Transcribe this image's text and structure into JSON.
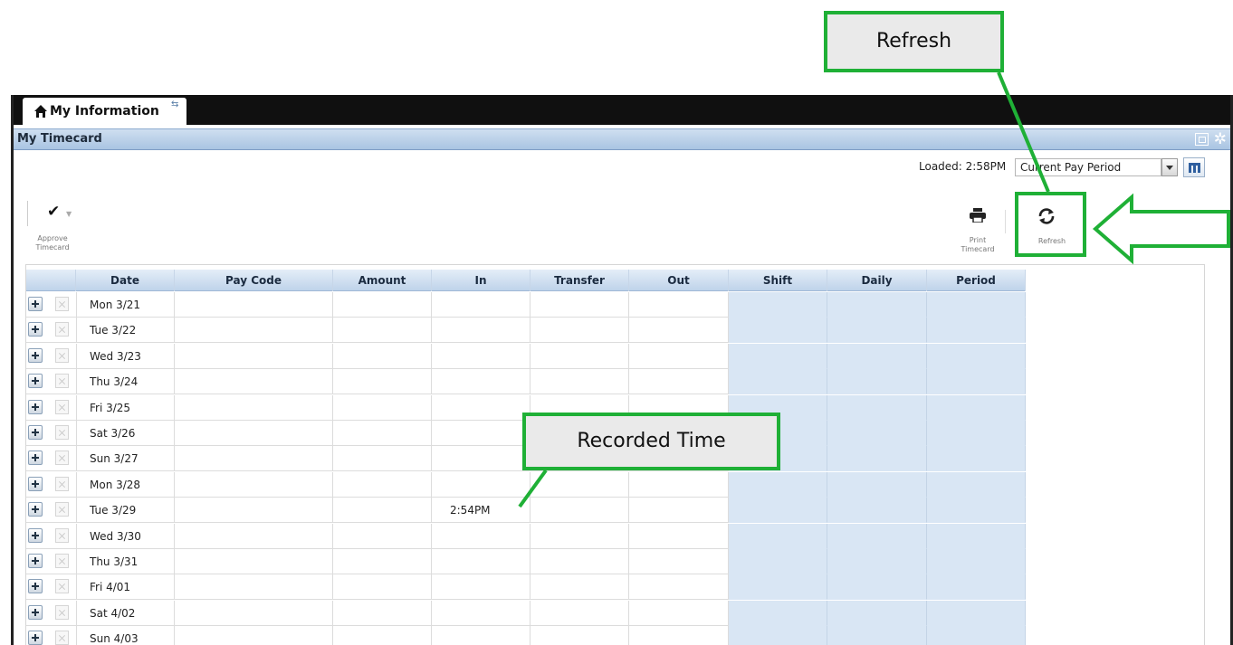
{
  "tab": {
    "label": "My Information",
    "sync_glyph": "⇆",
    "icon": "home-icon"
  },
  "panel": {
    "title": "My Timecard"
  },
  "loaded": {
    "text": "Loaded: 2:58PM"
  },
  "period_select": {
    "value": "Current Pay Period"
  },
  "toolbar": {
    "approve_label_1": "Approve",
    "approve_label_2": "Timecard",
    "print_label_1": "Print",
    "print_label_2": "Timecard",
    "refresh_label": "Refresh"
  },
  "table": {
    "columns": [
      "Date",
      "Pay Code",
      "Amount",
      "In",
      "Transfer",
      "Out",
      "Shift",
      "Daily",
      "Period"
    ],
    "rows": [
      {
        "date": "Mon 3/21",
        "in": ""
      },
      {
        "date": "Tue 3/22",
        "in": ""
      },
      {
        "date": "Wed 3/23",
        "in": ""
      },
      {
        "date": "Thu 3/24",
        "in": ""
      },
      {
        "date": "Fri 3/25",
        "in": ""
      },
      {
        "date": "Sat 3/26",
        "in": ""
      },
      {
        "date": "Sun 3/27",
        "in": ""
      },
      {
        "date": "Mon 3/28",
        "in": ""
      },
      {
        "date": "Tue 3/29",
        "in": "2:54PM"
      },
      {
        "date": "Wed 3/30",
        "in": ""
      },
      {
        "date": "Thu 3/31",
        "in": ""
      },
      {
        "date": "Fri 4/01",
        "in": ""
      },
      {
        "date": "Sat 4/02",
        "in": ""
      },
      {
        "date": "Sun 4/03",
        "in": ""
      }
    ]
  },
  "callouts": {
    "refresh": "Refresh",
    "recorded": "Recorded Time"
  },
  "colors": {
    "callout_border": "#1fb036",
    "totals_bg": "#d9e6f4",
    "header_bg": "#bfd3ea"
  }
}
